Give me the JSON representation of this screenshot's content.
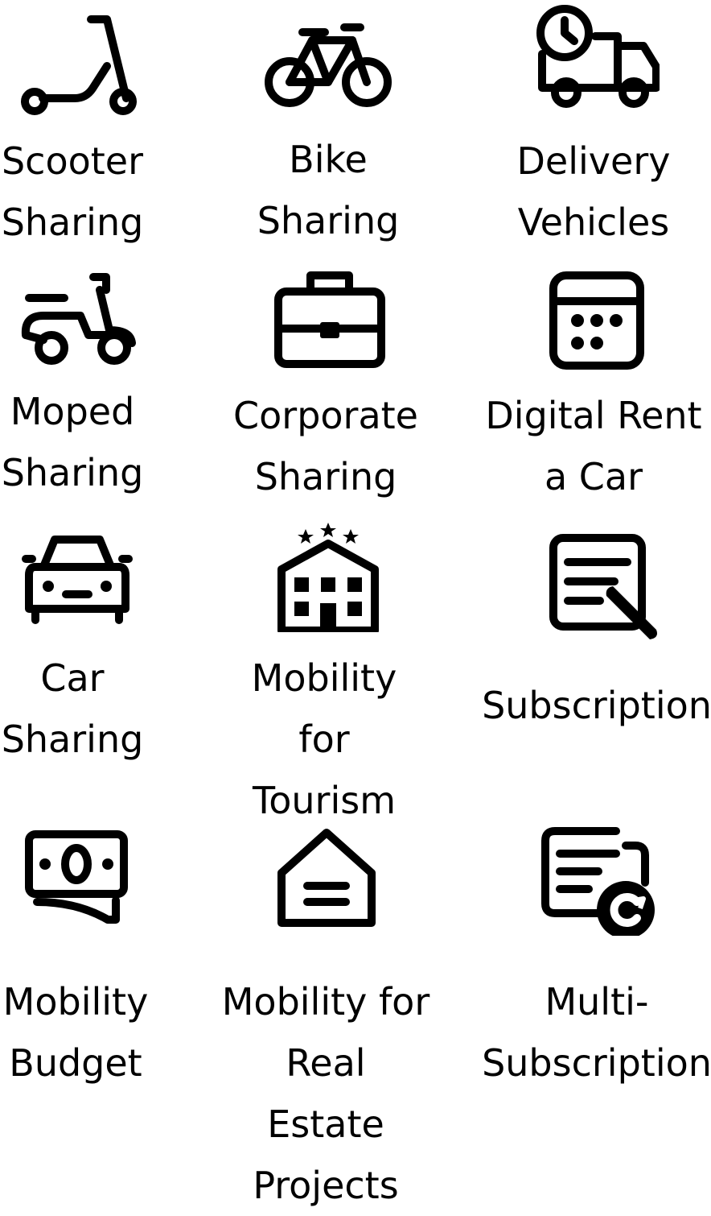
{
  "tiles": [
    {
      "icon": "scooter-icon",
      "label": "Scooter\nSharing"
    },
    {
      "icon": "bicycle-icon",
      "label": "Bike\nSharing"
    },
    {
      "icon": "delivery-truck-clock-icon",
      "label": "Delivery\nVehicles"
    },
    {
      "icon": "moped-icon",
      "label": "Moped\nSharing"
    },
    {
      "icon": "briefcase-icon",
      "label": "Corporate\nSharing"
    },
    {
      "icon": "calendar-icon",
      "label": "Digital Rent\na Car"
    },
    {
      "icon": "car-icon",
      "label": "Car\nSharing"
    },
    {
      "icon": "hotel-icon",
      "label": "Mobility\nfor\nTourism"
    },
    {
      "icon": "document-pen-icon",
      "label": "Subscription"
    },
    {
      "icon": "banknote-icon",
      "label": "Mobility\nBudget"
    },
    {
      "icon": "house-icon",
      "label": "Mobility for\nReal\nEstate Projects"
    },
    {
      "icon": "documents-refresh-icon",
      "label": "Multi-\nSubscription"
    }
  ]
}
